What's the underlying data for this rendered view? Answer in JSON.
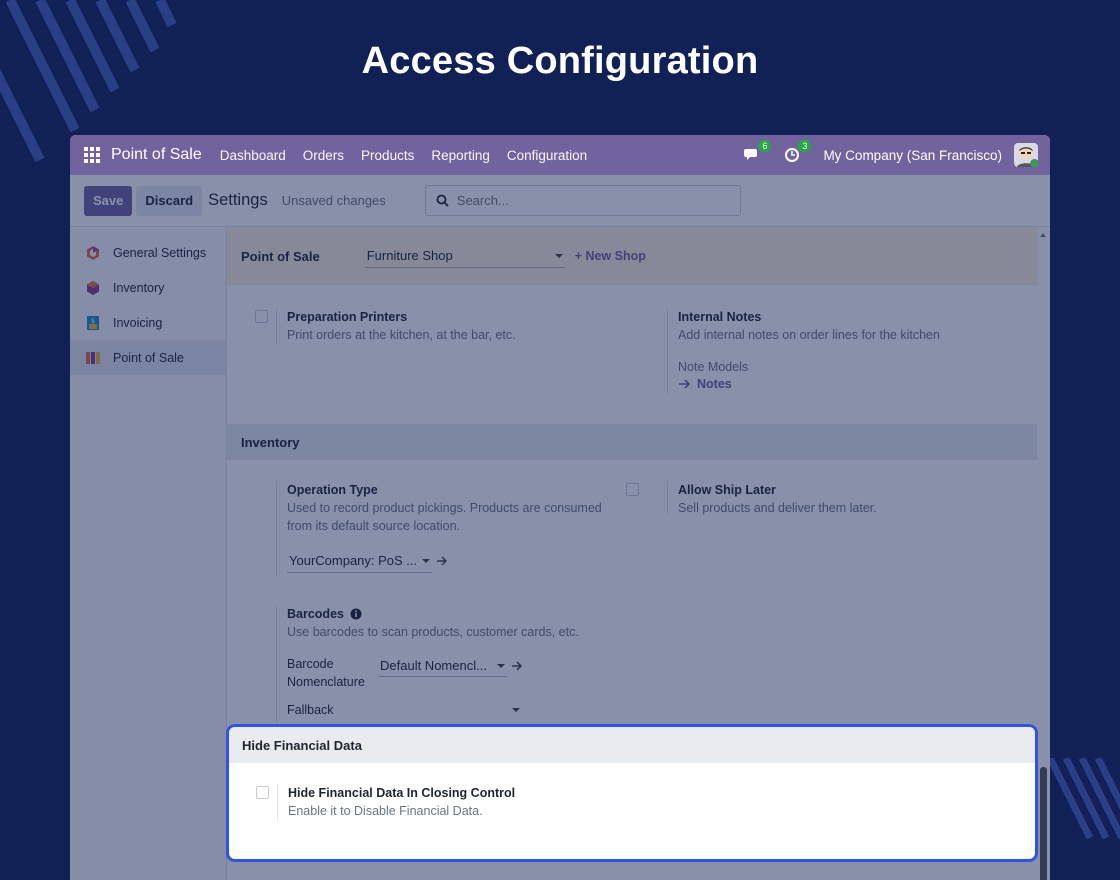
{
  "banner": {
    "title": "Access Configuration"
  },
  "nav": {
    "app_name": "Point of Sale",
    "links": [
      "Dashboard",
      "Orders",
      "Products",
      "Reporting",
      "Configuration"
    ],
    "messages_count": "6",
    "activities_count": "3",
    "company": "My Company (San Francisco)"
  },
  "control_panel": {
    "save_label": "Save",
    "discard_label": "Discard",
    "title": "Settings",
    "unsaved": "Unsaved changes",
    "search_placeholder": "Search..."
  },
  "sidebar": {
    "items": [
      {
        "label": "General Settings",
        "icon": "general-settings-icon"
      },
      {
        "label": "Inventory",
        "icon": "inventory-icon"
      },
      {
        "label": "Invoicing",
        "icon": "invoicing-icon"
      },
      {
        "label": "Point of Sale",
        "icon": "point-of-sale-icon",
        "active": true
      }
    ]
  },
  "pos_header": {
    "label": "Point of Sale",
    "shop": "Furniture Shop",
    "new_shop": "+ New Shop"
  },
  "settings": {
    "preparation_printers": {
      "title": "Preparation Printers",
      "desc": "Print orders at the kitchen, at the bar, etc."
    },
    "internal_notes": {
      "title": "Internal Notes",
      "desc": "Add internal notes on order lines for the kitchen",
      "sub_label": "Note Models",
      "link": "Notes"
    },
    "inventory_section": "Inventory",
    "operation_type": {
      "title": "Operation Type",
      "desc_line1": "Used to record product pickings. Products are consumed",
      "desc_line2": "from its default source location.",
      "value": "YourCompany: PoS ..."
    },
    "allow_ship_later": {
      "title": "Allow Ship Later",
      "desc": "Sell products and deliver them later."
    },
    "barcodes": {
      "title": "Barcodes",
      "desc": "Use barcodes to scan products, customer cards, etc.",
      "nomenclature_label_1": "Barcode",
      "nomenclature_label_2": "Nomenclature",
      "nomenclature_value": "Default Nomencl...",
      "fallback_label": "Fallback"
    }
  },
  "highlight": {
    "section": "Hide Financial Data",
    "title": "Hide Financial Data In Closing Control",
    "desc": "Enable it to Disable Financial Data."
  },
  "colors": {
    "background": "#112156",
    "brand": "#71639e",
    "highlight_border": "#2f55e0"
  }
}
